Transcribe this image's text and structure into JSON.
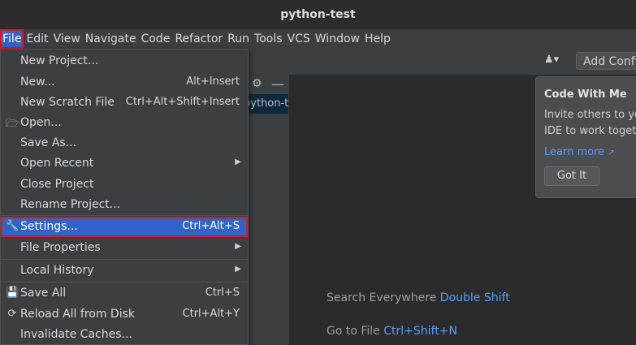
{
  "window": {
    "title": "python-test"
  },
  "menubar": [
    "File",
    "Edit",
    "View",
    "Navigate",
    "Code",
    "Refactor",
    "Run",
    "Tools",
    "VCS",
    "Window",
    "Help"
  ],
  "toolbar": {
    "add_config_label": "Add Configuration..."
  },
  "project_panel": {
    "row_label": "python-test"
  },
  "popup": {
    "title": "Code With Me",
    "body_line1": "Invite others to your",
    "body_line2": "IDE to work together",
    "link": "Learn more",
    "button": "Got It"
  },
  "hints": {
    "search_label": "Search Everywhere",
    "search_key": "Double Shift",
    "goto_label": "Go to File",
    "goto_key": "Ctrl+Shift+N"
  },
  "file_menu": [
    {
      "label": "New Project...",
      "shortcut": "",
      "icon": "",
      "submenu": false
    },
    {
      "label": "New...",
      "shortcut": "Alt+Insert",
      "icon": "",
      "submenu": false
    },
    {
      "label": "New Scratch File",
      "shortcut": "Ctrl+Alt+Shift+Insert",
      "icon": "",
      "submenu": false
    },
    {
      "label": "Open...",
      "shortcut": "",
      "icon": "folder-icon",
      "submenu": false
    },
    {
      "label": "Save As...",
      "shortcut": "",
      "icon": "",
      "submenu": false
    },
    {
      "label": "Open Recent",
      "shortcut": "",
      "icon": "",
      "submenu": true
    },
    {
      "label": "Close Project",
      "shortcut": "",
      "icon": "",
      "submenu": false
    },
    {
      "label": "Rename Project...",
      "shortcut": "",
      "icon": "",
      "submenu": false
    },
    {
      "label": "Settings...",
      "shortcut": "Ctrl+Alt+S",
      "icon": "wrench-icon",
      "submenu": false,
      "selected": true
    },
    {
      "label": "File Properties",
      "shortcut": "",
      "icon": "",
      "submenu": true
    },
    {
      "label": "Local History",
      "shortcut": "",
      "icon": "",
      "submenu": true
    },
    {
      "label": "Save All",
      "shortcut": "Ctrl+S",
      "icon": "save-icon",
      "submenu": false
    },
    {
      "label": "Reload All from Disk",
      "shortcut": "Ctrl+Alt+Y",
      "icon": "reload-icon",
      "submenu": false
    },
    {
      "label": "Invalidate Caches...",
      "shortcut": "",
      "icon": "",
      "submenu": false
    }
  ]
}
